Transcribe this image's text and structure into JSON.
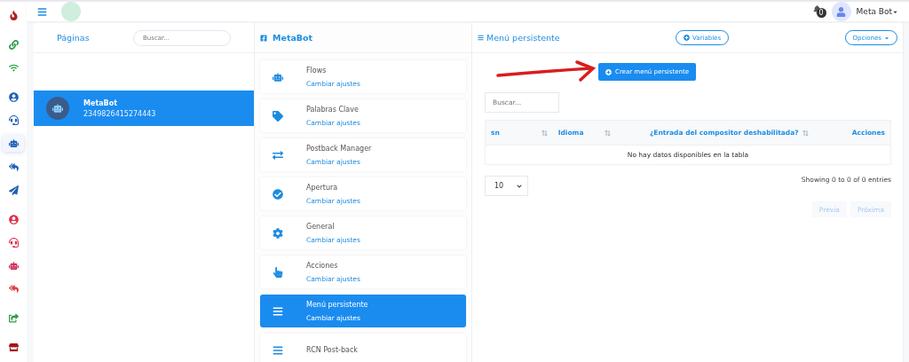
{
  "rail": [
    {
      "selected": false
    },
    {
      "selected": false
    },
    {
      "selected": false
    },
    {
      "selected": false
    },
    {
      "selected": false
    },
    {
      "selected": true
    },
    {
      "selected": false
    },
    {
      "selected": false
    },
    {
      "selected": false
    },
    {
      "selected": false
    },
    {
      "selected": false
    },
    {
      "selected": false
    },
    {
      "selected": false
    },
    {
      "selected": false
    }
  ],
  "header": {
    "user": "Meta Bot",
    "badge": "0"
  },
  "pages": {
    "title": "Páginas",
    "search": {
      "placeholder": "Buscar..."
    },
    "items": [
      {
        "name": "MetaBot",
        "id": "2349826415274443",
        "selected": true
      }
    ]
  },
  "bot": {
    "title": "MetaBot",
    "items": [
      {
        "title": "Flows",
        "link": "Cambiar ajustes",
        "selected": false
      },
      {
        "title": "Palabras Clave",
        "link": "Cambiar ajustes",
        "selected": false
      },
      {
        "title": "Postback Manager",
        "link": "Cambiar ajustes",
        "selected": false
      },
      {
        "title": "Apertura",
        "link": "Cambiar ajustes",
        "selected": false
      },
      {
        "title": "General",
        "link": "Cambiar ajustes",
        "selected": false
      },
      {
        "title": "Acciones",
        "link": "Cambiar ajustes",
        "selected": false
      },
      {
        "title": "Menú persistente",
        "link": "Cambiar ajustes",
        "selected": true
      },
      {
        "title": "RCN Post-back",
        "selected": false
      }
    ]
  },
  "panel": {
    "title": "Menú persistente",
    "variables": "Variables",
    "options": "Opciones",
    "create": "Crear menú persistente",
    "search": {
      "placeholder": "Buscar..."
    },
    "table": {
      "columns": [
        {
          "label": "sn",
          "sortable": true
        },
        {
          "label": "Idioma",
          "sortable": true
        },
        {
          "label": "¿Entrada del compositor deshabilitada?",
          "sortable": true
        },
        {
          "label": "Acciones",
          "sortable": false
        }
      ],
      "empty": "No hay datos disponibles en la tabla"
    },
    "page_size": "10",
    "info": "Showing 0 to 0 of 0 entries",
    "pager": [
      {
        "label": "Previa",
        "disabled": true
      },
      {
        "label": "Próxima",
        "disabled": true
      }
    ]
  }
}
